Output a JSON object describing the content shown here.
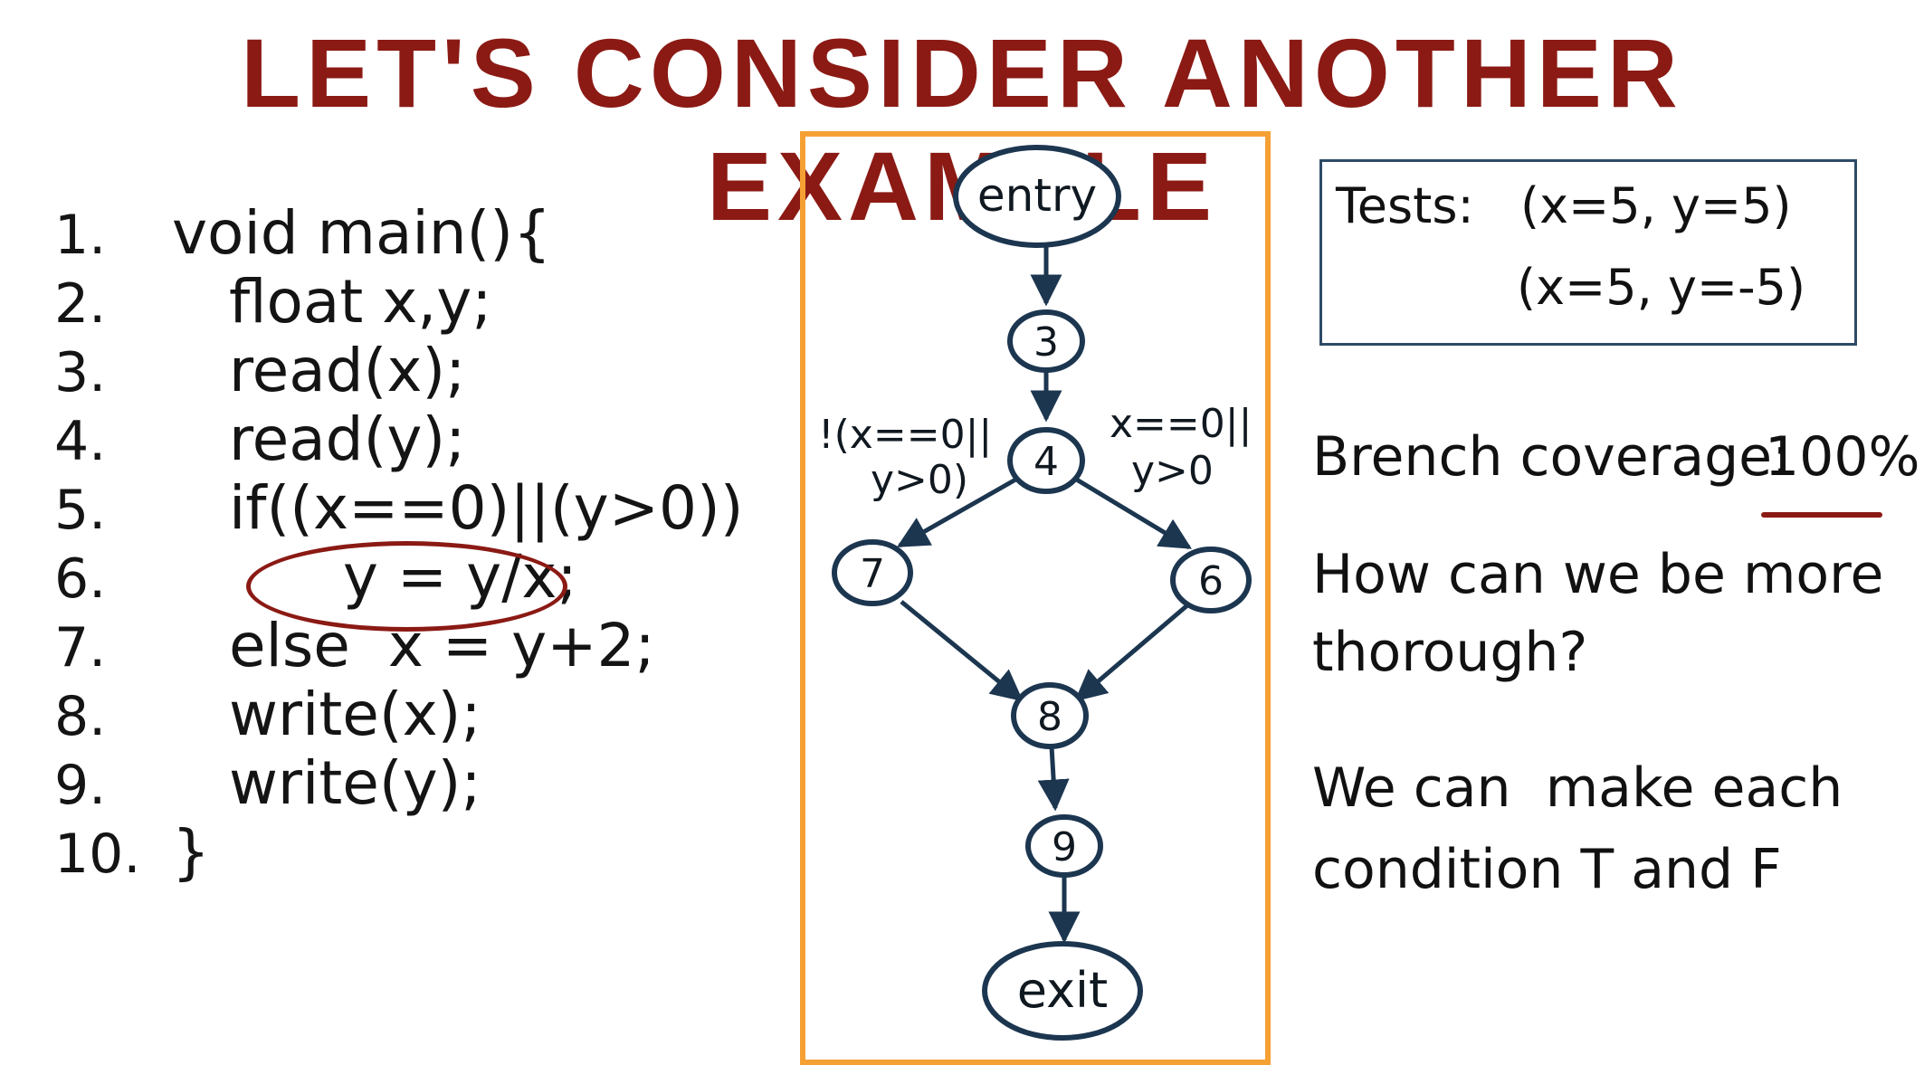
{
  "title": "LET'S CONSIDER ANOTHER EXAMPLE",
  "code": {
    "lines": [
      {
        "num": "1.",
        "text": "void main(){"
      },
      {
        "num": "2.",
        "text": "   float x,y;"
      },
      {
        "num": "3.",
        "text": "   read(x);"
      },
      {
        "num": "4.",
        "text": "   read(y);"
      },
      {
        "num": "5.",
        "text": "   if((x==0)||(y>0))"
      },
      {
        "num": "6.",
        "text": "         y = y/x;"
      },
      {
        "num": "7.",
        "text": "   else  x = y+2;"
      },
      {
        "num": "8.",
        "text": "   write(x);"
      },
      {
        "num": "9.",
        "text": "   write(y);"
      },
      {
        "num": "10.",
        "text": "}"
      }
    ]
  },
  "cfg": {
    "nodes": {
      "entry": "entry",
      "n3": "3",
      "n4": "4",
      "n7": "7",
      "n6": "6",
      "n8": "8",
      "n9": "9",
      "exit": "exit"
    },
    "labels": {
      "false_line1": "!(x==0||",
      "false_line2": "y>0)",
      "true_line1": "x==0||",
      "true_line2": "y>0"
    }
  },
  "tests": {
    "label": "Tests:",
    "case1": "(x=5, y=5)",
    "case2": "(x=5, y=-5)"
  },
  "notes": {
    "branch_label": "Brench coverage:",
    "branch_value": "100%",
    "question_line1": "How can we be more",
    "question_line2": "thorough?",
    "answer_line1": "We can  make each",
    "answer_line2": "condition T and F"
  },
  "colors": {
    "title": "#8b1a14",
    "frame": "#f5a033",
    "graph": "#1c3650",
    "ink": "#111111"
  }
}
